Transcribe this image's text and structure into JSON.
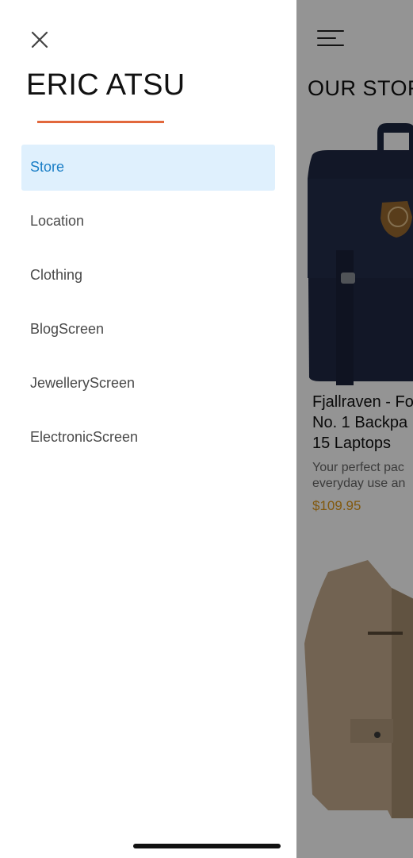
{
  "drawer": {
    "title": "ERIC ATSU",
    "items": [
      {
        "label": "Store",
        "active": true
      },
      {
        "label": "Location",
        "active": false
      },
      {
        "label": "Clothing",
        "active": false
      },
      {
        "label": "BlogScreen",
        "active": false
      },
      {
        "label": "JewelleryScreen",
        "active": false
      },
      {
        "label": "ElectronicScreen",
        "active": false
      }
    ],
    "close_icon": "close-icon",
    "accent_color": "#e2683c",
    "active_color": "#1a7ec6",
    "active_bg": "#dff0fd"
  },
  "app": {
    "title": "OUR STORY",
    "menu_icon": "hamburger-menu-icon",
    "products": [
      {
        "name_lines": [
          "Fjallraven - Fo",
          "No. 1 Backpa",
          "15 Laptops"
        ],
        "desc_lines": [
          "Your perfect pac",
          "everyday use an"
        ],
        "price": "$109.95",
        "image": "backpack-image"
      },
      {
        "image": "jacket-image"
      }
    ]
  }
}
